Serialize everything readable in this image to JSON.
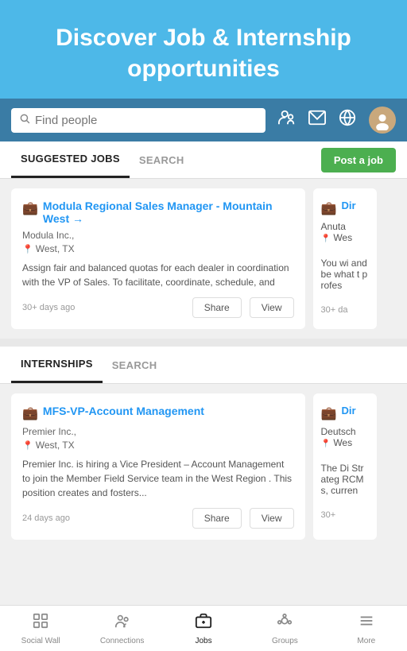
{
  "hero": {
    "title": "Discover Job & Internship opportunities"
  },
  "search": {
    "placeholder": "Find people"
  },
  "nav_icons": {
    "people": "👤",
    "mail": "✉",
    "globe": "🌐"
  },
  "jobs_tabs": {
    "suggested": "SUGGESTED JOBS",
    "search": "SEARCH",
    "post_label": "Post a job"
  },
  "job_cards": [
    {
      "title": "Modula Regional Sales Manager - Mountain West →",
      "company": "Modula Inc.,",
      "location": "West, TX",
      "description": "Assign fair and balanced quotas for each dealer in coordination with the VP of Sales. To facilitate, coordinate, schedule, and",
      "time": "30+ days ago",
      "share_label": "Share",
      "view_label": "View"
    }
  ],
  "job_card_partial": {
    "title": "Dir",
    "company": "Anuta",
    "location": "Wes",
    "description": "You wi and be what t profes",
    "time": "30+ da"
  },
  "internship_tabs": {
    "internships": "INTERNSHIPS",
    "search": "SEARCH"
  },
  "internship_cards": [
    {
      "title": "MFS-VP-Account Management",
      "company": "Premier Inc.,",
      "location": "West, TX",
      "description": "Premier Inc. is hiring a Vice President – Account Management to join the Member Field Service team in the West Region . This position creates and fosters...",
      "time": "24 days ago",
      "share_label": "Share",
      "view_label": "View"
    }
  ],
  "internship_card_partial": {
    "title": "Dir",
    "company": "Deutsch",
    "location": "Wes",
    "description": "The Di Strateg RCMs, curren",
    "time": "30+"
  },
  "bottom_nav": {
    "items": [
      {
        "label": "Social Wall",
        "icon": "⊞",
        "active": false
      },
      {
        "label": "Connections",
        "icon": "👥",
        "active": false
      },
      {
        "label": "Jobs",
        "icon": "💼",
        "active": true
      },
      {
        "label": "Groups",
        "icon": "⊛",
        "active": false
      },
      {
        "label": "More",
        "icon": "≡",
        "active": false
      }
    ]
  }
}
